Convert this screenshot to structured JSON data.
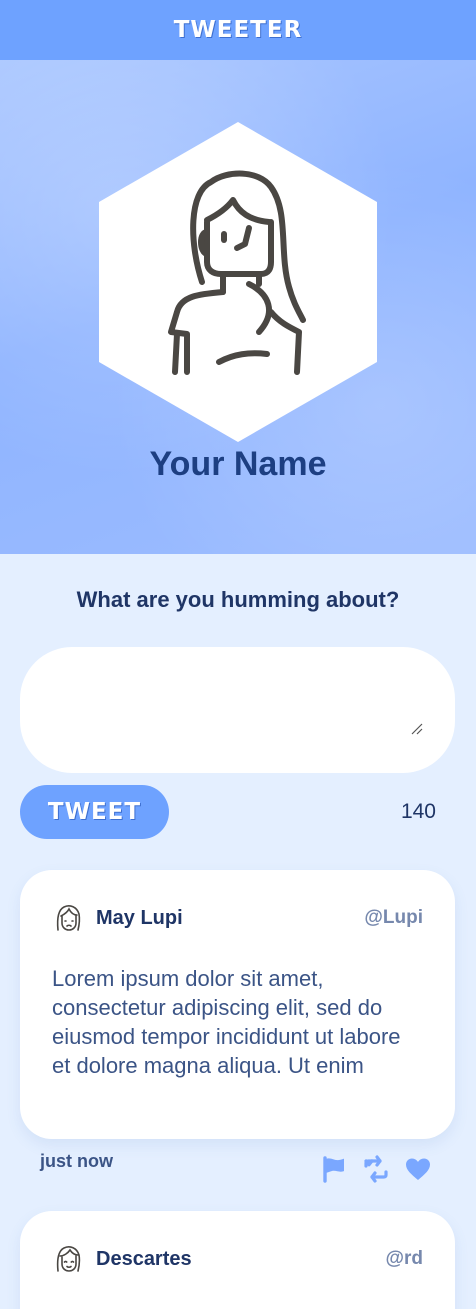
{
  "app": {
    "title": "TWEETER"
  },
  "profile": {
    "name": "Your Name",
    "avatar_icon": "woman-avatar-icon"
  },
  "composer": {
    "prompt": "What are you humming about?",
    "value": "",
    "button_label": "TWEET",
    "char_count": "140"
  },
  "feed": {
    "tweets": [
      {
        "author": "May Lupi",
        "handle": "@Lupi",
        "avatar_icon": "woman-face-icon",
        "text": "Lorem ipsum dolor sit amet, consectetur adipiscing elit, sed do eiusmod tempor incididunt ut labore et dolore magna aliqua. Ut enim",
        "time": "just now",
        "actions": [
          "flag-icon",
          "retweet-icon",
          "heart-icon"
        ]
      },
      {
        "author": "Descartes",
        "handle": "@rd",
        "avatar_icon": "woman-face-icon"
      }
    ]
  },
  "colors": {
    "accent": "#6ea2ff",
    "background": "#e4efff",
    "text_dark": "#1f3566",
    "handle_gray": "#7688ad",
    "icon_blue": "#7aa7ff"
  }
}
